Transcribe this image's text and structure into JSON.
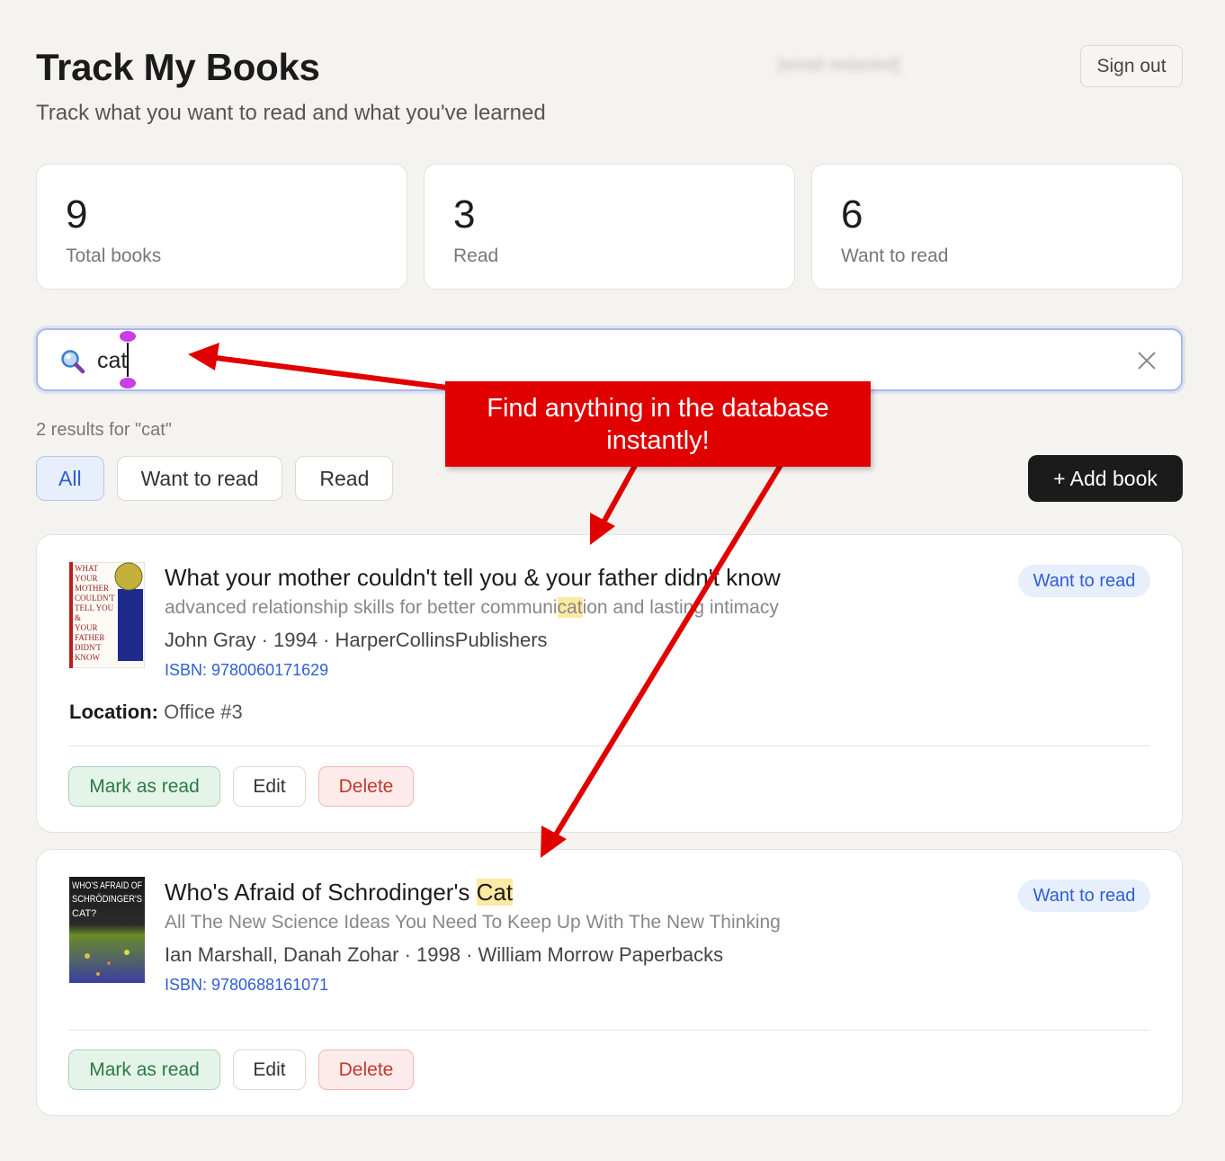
{
  "app": {
    "title": "Track My Books",
    "subtitle": "Track what you want to read and what you've learned",
    "user_email": "[email redacted]",
    "sign_out_label": "Sign out"
  },
  "stats": [
    {
      "value": "9",
      "label": "Total books"
    },
    {
      "value": "3",
      "label": "Read"
    },
    {
      "value": "6",
      "label": "Want to read"
    }
  ],
  "search": {
    "value": "cat",
    "placeholder": "Search books"
  },
  "results_text": "2 results for \"cat\"",
  "filters": [
    {
      "label": "All",
      "active": true
    },
    {
      "label": "Want to read",
      "active": false
    },
    {
      "label": "Read",
      "active": false
    }
  ],
  "add_book_label": "+ Add book",
  "books": [
    {
      "title": "What your mother couldn't tell you & your father didn't know",
      "subtitle_before": "advanced relationship skills for better communi",
      "subtitle_match": "cat",
      "subtitle_after": "ion and lasting intimacy",
      "meta": "John Gray · 1994 · HarperCollinsPublishers",
      "isbn": "ISBN: 9780060171629",
      "status": "Want to read",
      "location_label": "Location:",
      "location_value": "Office #3",
      "cover_text": [
        "WHAT",
        "YOUR",
        "MOTHER",
        "COULDN'T",
        "TELL YOU",
        "&",
        "YOUR",
        "FATHER",
        "DIDN'T",
        "KNOW"
      ],
      "actions": {
        "mark": "Mark as read",
        "edit": "Edit",
        "delete": "Delete"
      }
    },
    {
      "title_before": "Who's Afraid of Schrodinger's ",
      "title_match": "Cat",
      "subtitle": "All The New Science Ideas You Need To Keep Up With The New Thinking",
      "meta": "Ian Marshall, Danah Zohar · 1998 · William Morrow Paperbacks",
      "isbn": "ISBN: 9780688161071",
      "status": "Want to read",
      "cover_text": [
        "WHO'S AFRAID OF",
        "SCHRÖDINGER'S",
        "CAT?"
      ],
      "actions": {
        "mark": "Mark as read",
        "edit": "Edit",
        "delete": "Delete"
      }
    }
  ],
  "annotation": {
    "callout_text": "Find anything in the database instantly!",
    "arrow_color": "#e00000"
  }
}
